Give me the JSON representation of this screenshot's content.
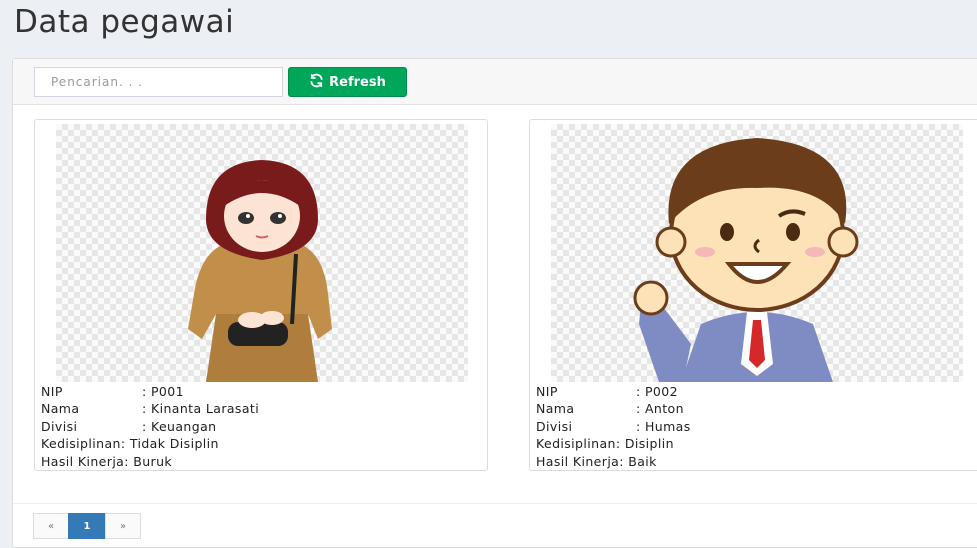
{
  "page": {
    "title": "Data pegawai"
  },
  "toolbar": {
    "search_placeholder": "Pencarian. . .",
    "refresh_label": "Refresh",
    "accent_color": "#00a65a"
  },
  "labels": {
    "nip": "NIP",
    "nama": "Nama",
    "divisi": "Divisi",
    "kedisiplinan": "Kedisiplinan",
    "hasil_kinerja": "Hasil Kinerja"
  },
  "employees": [
    {
      "nip": ": P001",
      "nama": ": Kinanta Larasati",
      "divisi": ": Keuangan",
      "kedisiplinan": ": Tidak Disiplin",
      "hasil_kinerja": ": Buruk"
    },
    {
      "nip": ": P002",
      "nama": ": Anton",
      "divisi": ": Humas",
      "kedisiplinan": ": Disiplin",
      "hasil_kinerja": ": Baik"
    }
  ],
  "pagination": {
    "prev": "«",
    "current": "1",
    "next": "»"
  }
}
